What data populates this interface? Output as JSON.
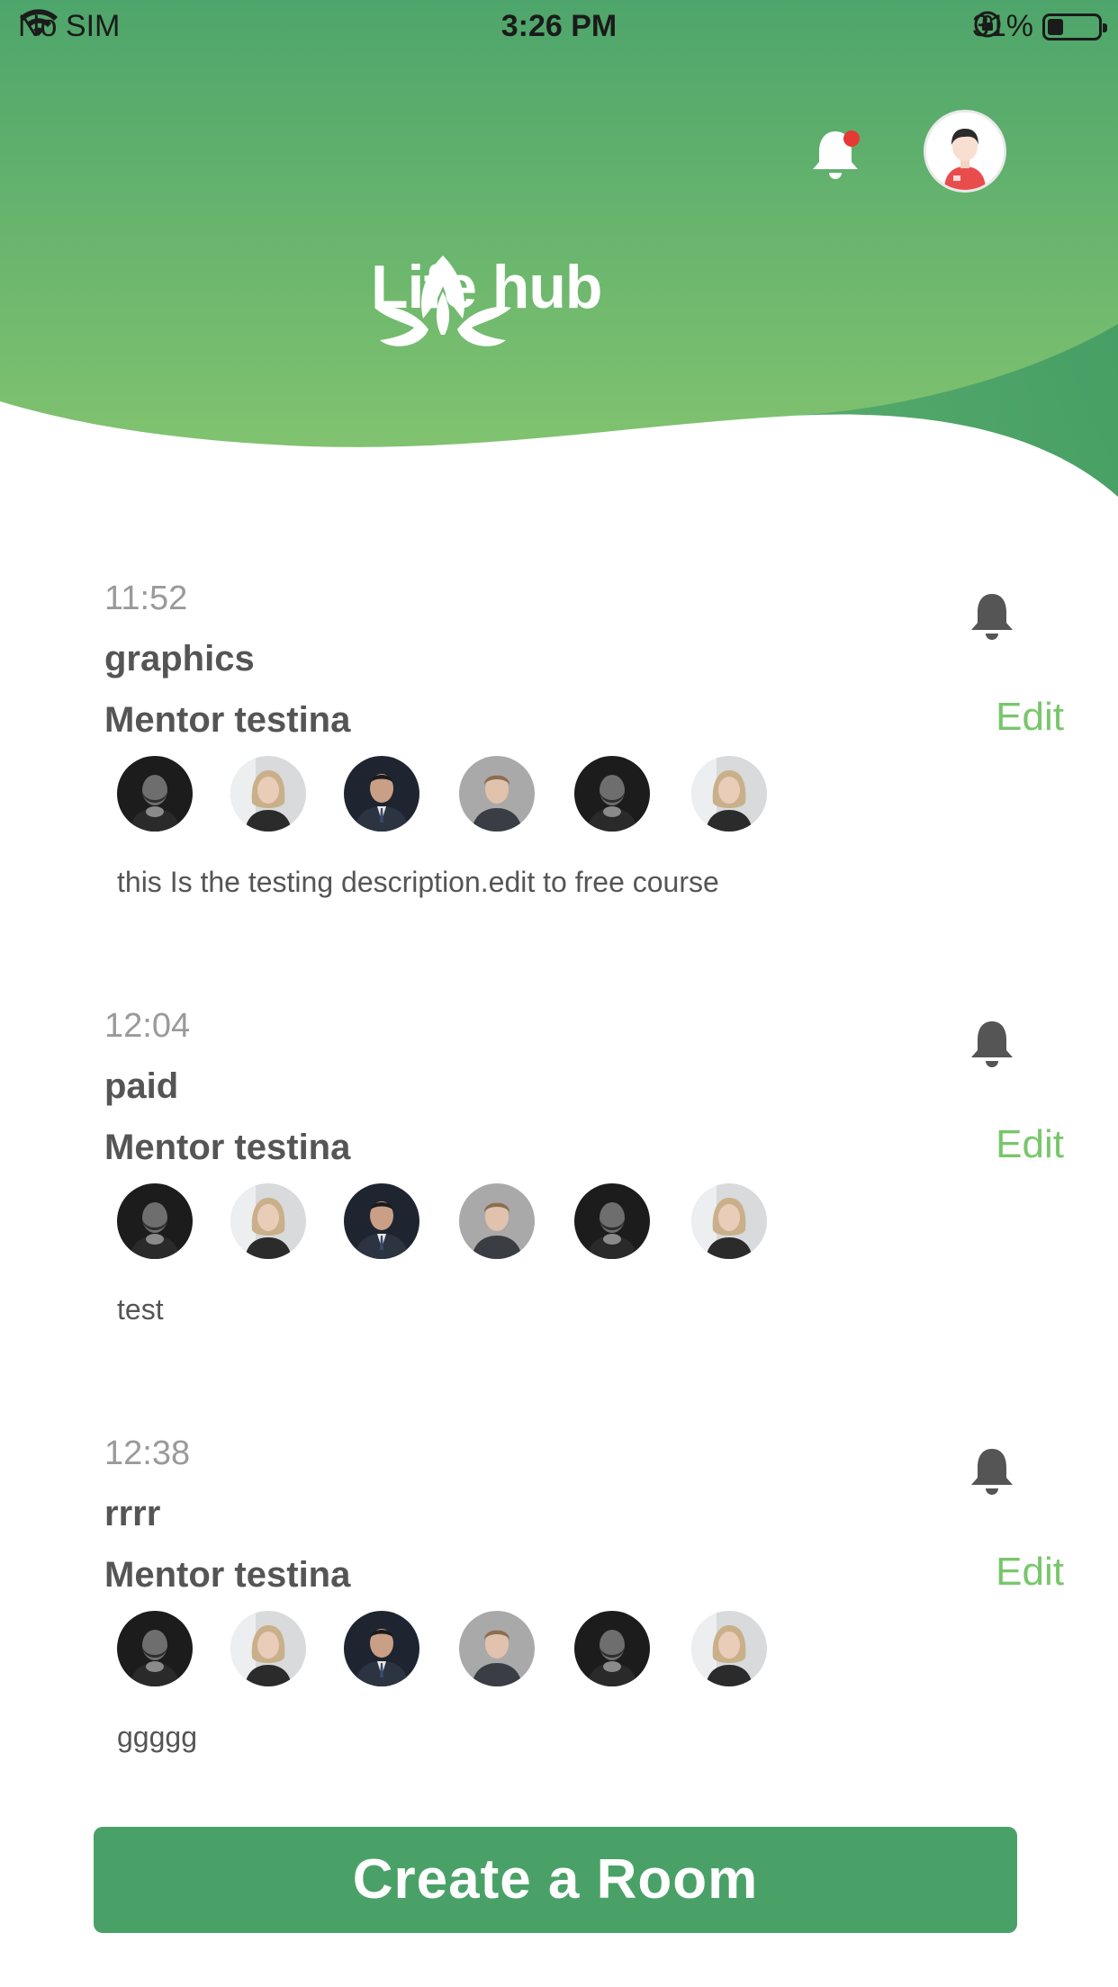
{
  "status_bar": {
    "carrier": "No SIM",
    "time": "3:26 PM",
    "battery": "31%",
    "battery_level": 0.31
  },
  "header": {
    "app_name": "Life hub",
    "has_unread_notifications": true,
    "colors": {
      "top": "#4ea56b",
      "bottom": "#82c36f",
      "accent_dot": "#e53935"
    }
  },
  "rooms": [
    {
      "time": "11:52",
      "title": "graphics",
      "mentor": "Mentor testina",
      "edit_label": "Edit",
      "description": "this Is the testing description.edit to free course",
      "participants": [
        "dark-man",
        "blonde-woman",
        "suit-man",
        "light-man",
        "dark-man",
        "blonde-woman"
      ]
    },
    {
      "time": "12:04",
      "title": "paid",
      "mentor": "Mentor testina",
      "edit_label": "Edit",
      "description": "test",
      "participants": [
        "dark-man",
        "blonde-woman",
        "suit-man",
        "light-man",
        "dark-man",
        "blonde-woman"
      ]
    },
    {
      "time": "12:38",
      "title": "rrrr",
      "mentor": "Mentor testina",
      "edit_label": "Edit",
      "description": "ggggg",
      "participants": [
        "dark-man",
        "blonde-woman",
        "suit-man",
        "light-man",
        "dark-man",
        "blonde-woman"
      ]
    }
  ],
  "create_button": {
    "label": "Create a Room",
    "color": "#4aa168"
  },
  "icons": {
    "wifi": "wifi-icon",
    "rotation_lock": "rotation-lock-icon",
    "battery": "battery-icon",
    "notification": "bell-icon",
    "profile": "avatar-icon"
  }
}
